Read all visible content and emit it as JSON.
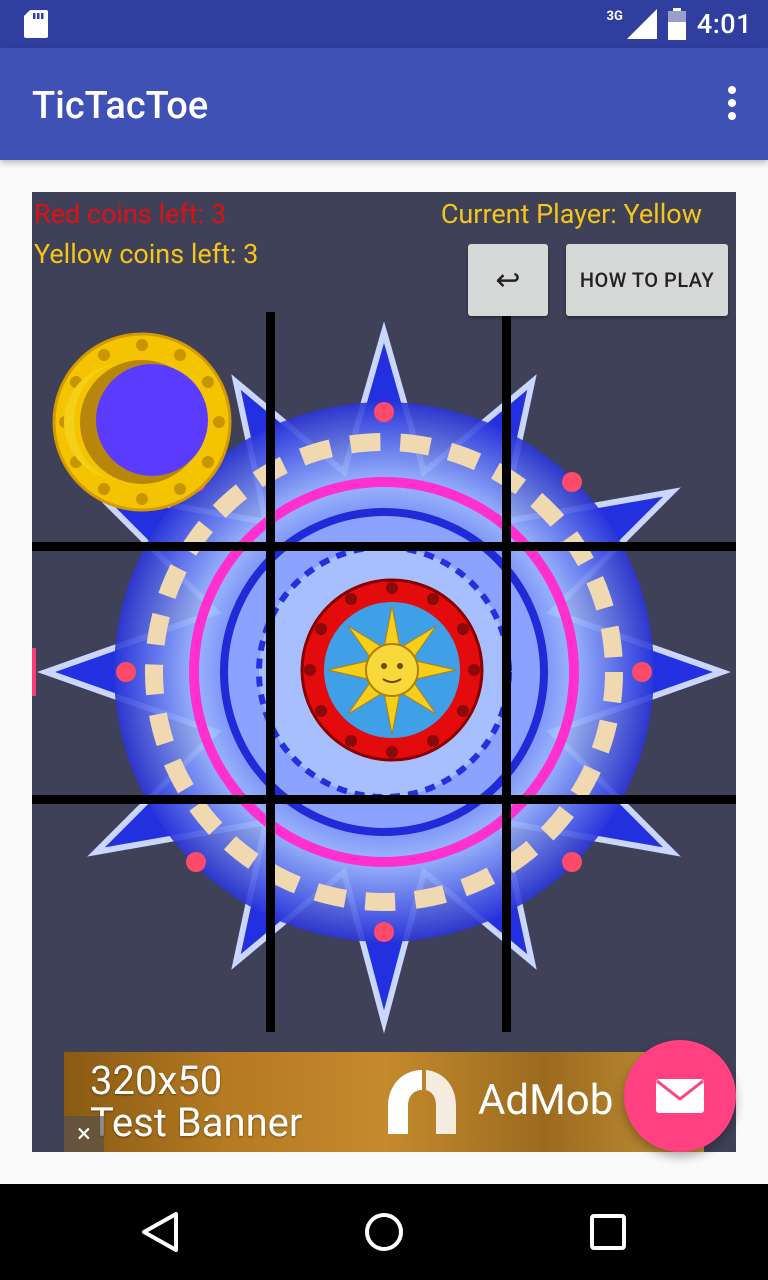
{
  "status_bar": {
    "network": "3G",
    "time": "4:01",
    "icons": [
      "sd-card-icon",
      "signal-icon",
      "battery-icon"
    ]
  },
  "app_bar": {
    "title": "TicTacToe",
    "menu_icon": "more-vert-icon"
  },
  "game": {
    "red_coins_text": "Red coins left: 3",
    "yellow_coins_text": "Yellow coins left: 3",
    "current_player_text": "Current Player: Yellow",
    "undo_icon": "↩",
    "how_to_play_label": "HOW TO PLAY",
    "pieces": [
      {
        "cell": "row1-col1",
        "type": "yellow-moon-coin"
      },
      {
        "cell": "row2-col2",
        "type": "red-sun-coin"
      }
    ],
    "colors": {
      "red_text": "#e10f0f",
      "yellow_text": "#f5c518",
      "board_bg": "#3f4158"
    }
  },
  "ad_banner": {
    "text": "320x50\nTest Banner",
    "brand": "AdMob",
    "close": "×"
  },
  "fab": {
    "icon": "mail-icon"
  },
  "nav_bar": {
    "buttons": [
      "back-icon",
      "home-icon",
      "recents-icon"
    ]
  }
}
